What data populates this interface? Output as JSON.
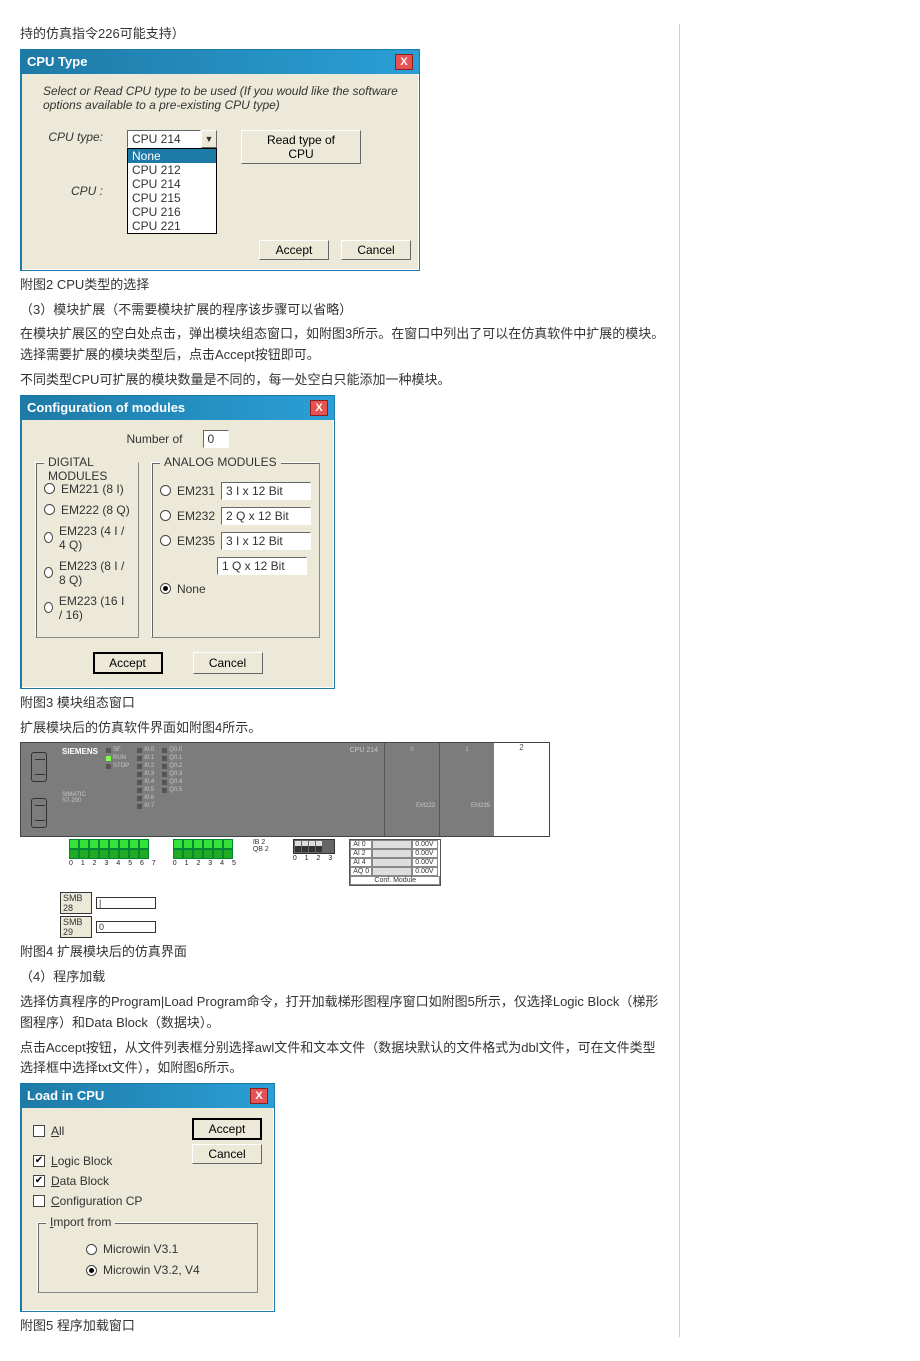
{
  "text": {
    "p0": "持的仿真指令226可能支持）",
    "cap2": "附图2 CPU类型的选择",
    "p3": "（3）模块扩展（不需要模块扩展的程序该步骤可以省略）",
    "p3a": "在模块扩展区的空白处点击，弹出模块组态窗口，如附图3所示。在窗口中列出了可以在仿真软件中扩展的模块。选择需要扩展的模块类型后，点击Accept按钮即可。",
    "p3b": "不同类型CPU可扩展的模块数量是不同的，每一处空白只能添加一种模块。",
    "cap3": "附图3 模块组态窗口",
    "p4a": "扩展模块后的仿真软件界面如附图4所示。",
    "cap4": "附图4 扩展模块后的仿真界面",
    "p5": "（4）程序加载",
    "p5a": "选择仿真程序的Program|Load Program命令，打开加载梯形图程序窗口如附图5所示，仅选择Logic Block（梯形图程序）和Data Block（数据块）。",
    "p5b": "点击Accept按钮，从文件列表框分别选择awl文件和文本文件（数据块默认的文件格式为dbl文件，可在文件类型选择框中选择txt文件），如附图6所示。",
    "cap5": "附图5 程序加载窗口"
  },
  "fig2": {
    "title": "CPU Type",
    "desc": "Select or Read CPU type to be used (If you would like the software options available to a pre-existing CPU type)",
    "lbl_type": "CPU type:",
    "lbl_cpu": "CPU :",
    "combo_sel": "CPU 214",
    "options": [
      "None",
      "CPU 212",
      "CPU 214",
      "CPU 215",
      "CPU 216",
      "CPU 221"
    ],
    "btn_read": "Read type of CPU",
    "btn_accept": "Accept",
    "btn_cancel": "Cancel"
  },
  "fig3": {
    "title": "Configuration of modules",
    "numlabel": "Number of",
    "numvalue": "0",
    "dig_title": "DIGITAL MODULES",
    "ana_title": "ANALOG MODULES",
    "dig": [
      {
        "label": "EM221",
        "desc": "(8 I)"
      },
      {
        "label": "EM222",
        "desc": "(8 Q)"
      },
      {
        "label": "EM223",
        "desc": "(4 I /  4 Q)"
      },
      {
        "label": "EM223",
        "desc": "(8 I /  8 Q)"
      },
      {
        "label": "EM223",
        "desc": "(16 I / 16)"
      }
    ],
    "ana": [
      {
        "label": "EM231",
        "tx": "3 I x 12 Bit"
      },
      {
        "label": "EM232",
        "tx": "2 Q x 12 Bit"
      },
      {
        "label": "EM235",
        "tx": "3 I x 12 Bit"
      },
      {
        "label_extra_tx": "1 Q x 12 Bit"
      }
    ],
    "none": "None",
    "accept": "Accept",
    "cancel": "Cancel"
  },
  "fig4": {
    "brand": "SIEMENS",
    "model1": "SIMATIC",
    "model2": "S7-200",
    "cpu": "CPU 214",
    "mod0": "0",
    "mod0name": "EM223",
    "mod1": "1",
    "mod1name": "EM235",
    "slot2": "2",
    "io_in_nums": "0 1 2 3 4 5 6 7",
    "io_out_nums": "0 1 2 3 4 5",
    "q_label1": "IB 2",
    "q_label2": "QB 2",
    "dip_nums": "0 1 2 3",
    "aio": [
      [
        "AI 0",
        "",
        "0.00V"
      ],
      [
        "AI 2",
        "",
        "0.00V"
      ],
      [
        "AI 4",
        "",
        "0.00V"
      ],
      [
        "AQ 0",
        "",
        "0.00V"
      ]
    ],
    "conf": "Conf. Module",
    "smb1_l": "SMB 28",
    "smb1_v": "|",
    "smb2_l": "SMB 29",
    "smb2_v": "0"
  },
  "fig5": {
    "title": "Load in CPU",
    "all": "All",
    "logic": "Logic Block",
    "data": "Data Block",
    "conf": "Configuration CP",
    "import": "Import from",
    "r1": "Microwin V3.1",
    "r2": "Microwin V3.2, V4",
    "accept": "Accept",
    "cancel": "Cancel"
  }
}
